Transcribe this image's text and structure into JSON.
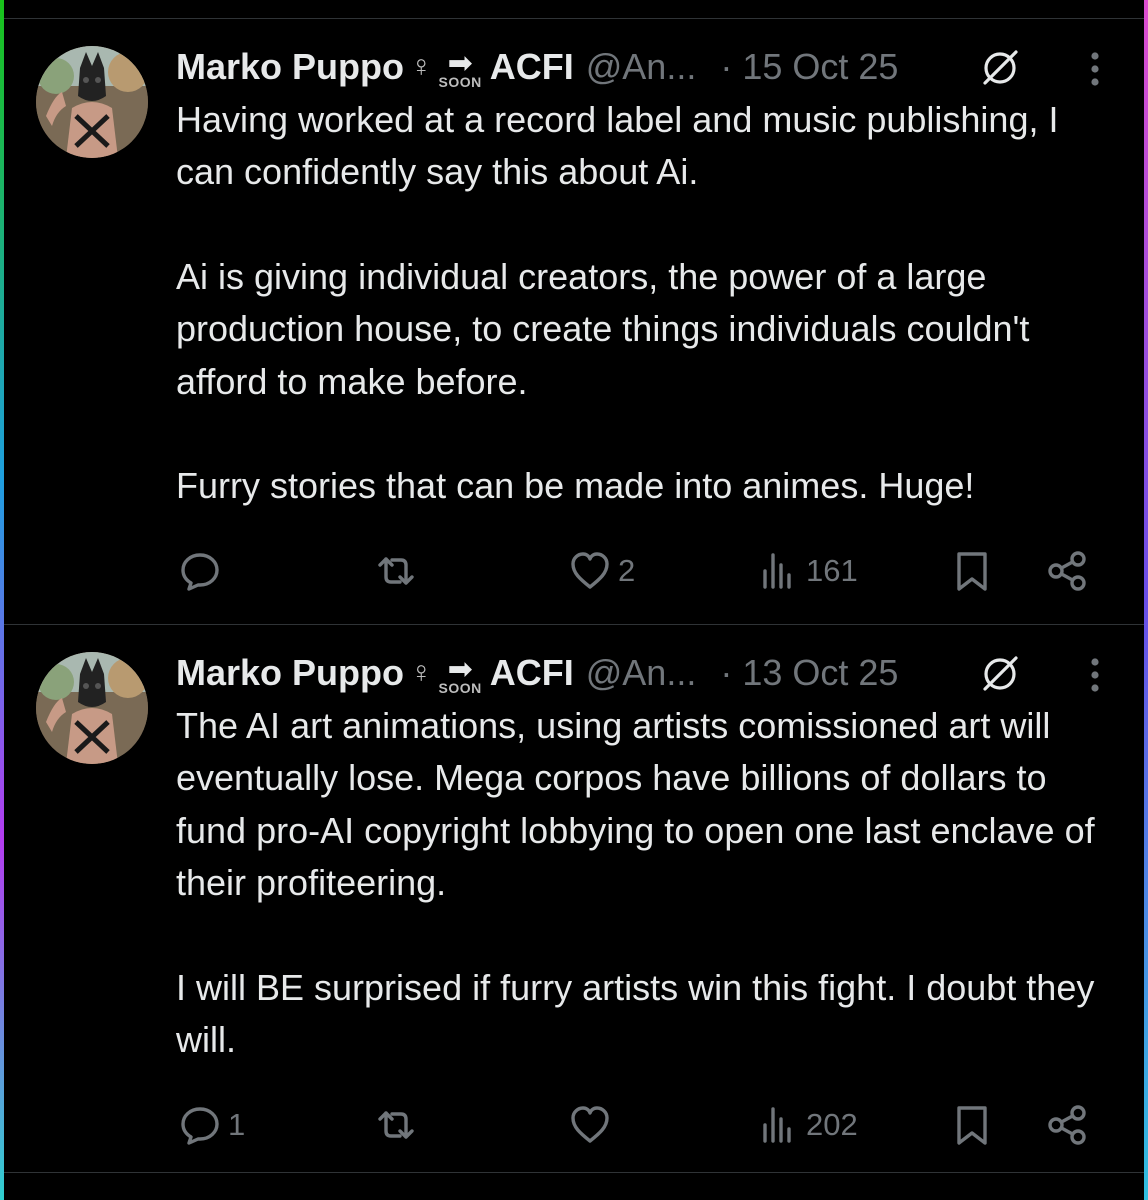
{
  "tweets": [
    {
      "display_name": "Marko Puppo",
      "symbol": "♀",
      "arrow": "➡",
      "arrow_label": "SOON",
      "tag": "ACFI",
      "handle": "@An...",
      "date": "· 15 Oct 25",
      "paragraphs": [
        "Having worked at a record label and music publishing, I can confidently say this about Ai.",
        "Ai is giving individual creators, the power of a large production house, to create things individuals couldn't afford to make before.",
        "Furry stories that can be made into animes. Huge!"
      ],
      "replies": "",
      "reposts": "",
      "likes": "2",
      "views": "161"
    },
    {
      "display_name": "Marko Puppo",
      "symbol": "♀",
      "arrow": "➡",
      "arrow_label": "SOON",
      "tag": "ACFI",
      "handle": "@An...",
      "date": "· 13 Oct 25",
      "paragraphs": [
        "The AI art animations, using artists comissioned art will eventually lose. Mega corpos have billions of dollars to fund pro-AI copyright lobbying to open one last enclave of their profiteering.",
        "I will BE surprised if furry artists win this fight. I doubt they will."
      ],
      "replies": "1",
      "reposts": "",
      "likes": "",
      "views": "202"
    }
  ],
  "icons": {
    "reply": "speech-bubble-icon",
    "repost": "repost-arrows-icon",
    "like": "heart-icon",
    "views": "bar-chart-icon",
    "bookmark": "bookmark-icon",
    "share": "share-icon",
    "grok": "grok-icon",
    "more": "more-dots-icon"
  },
  "colors": {
    "background": "#000000",
    "text": "#e7e9ea",
    "muted": "#71767b",
    "divider": "#2f3336"
  }
}
